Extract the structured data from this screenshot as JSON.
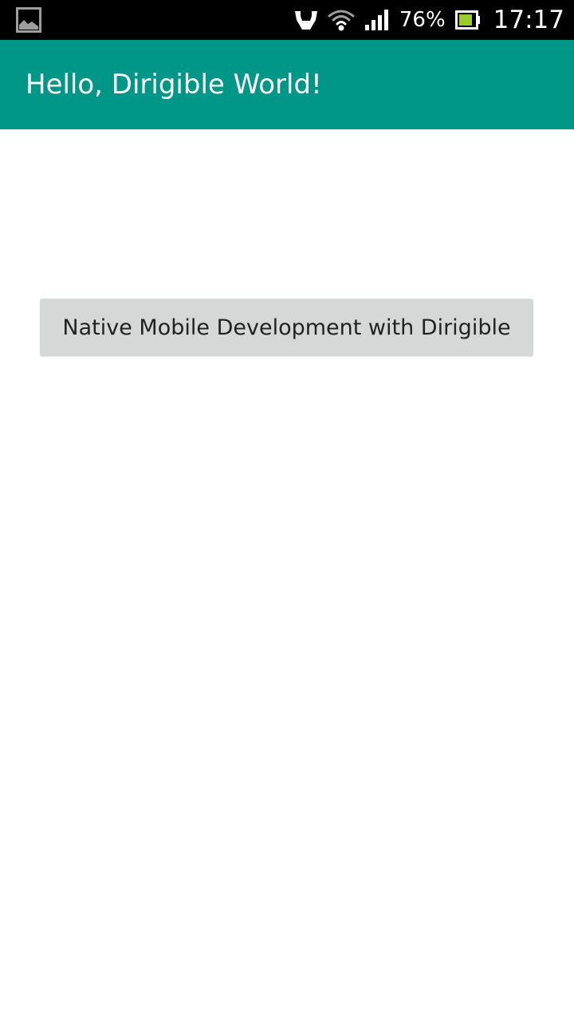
{
  "status_bar": {
    "left_icon": "picture-icon",
    "icons": [
      "download-icon",
      "wifi-icon",
      "signal-icon"
    ],
    "battery_percent": "76%",
    "battery_icon": "battery-icon",
    "time": "17:17"
  },
  "app_bar": {
    "title": "Hello, Dirigible World!",
    "color": "#009688"
  },
  "main": {
    "button_label": "Native Mobile Development with Dirigible"
  }
}
